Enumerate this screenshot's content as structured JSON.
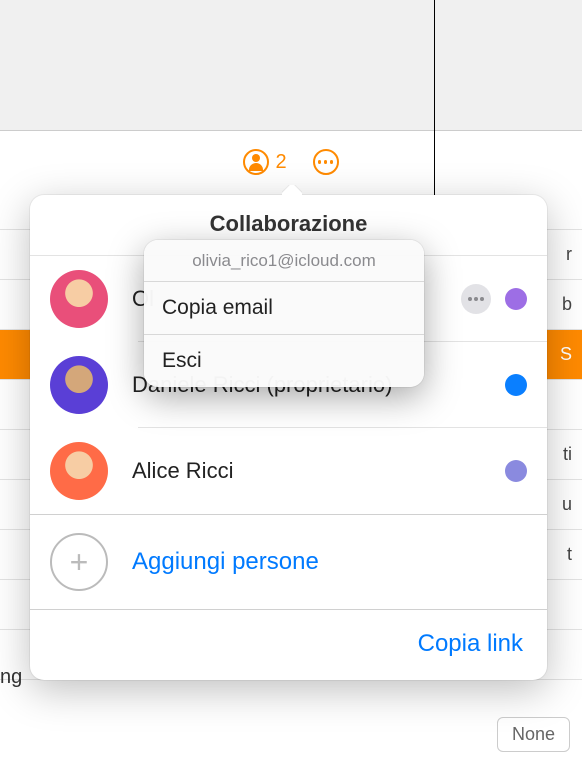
{
  "toolbar": {
    "collab_count": "2"
  },
  "popover": {
    "title": "Collaborazione",
    "participants": [
      {
        "name": "Ol",
        "has_more": true,
        "color": "purple"
      },
      {
        "name": "Daniele Ricci (proprietario)",
        "has_more": false,
        "color": "blue"
      },
      {
        "name": "Alice Ricci",
        "has_more": false,
        "color": "lav"
      }
    ],
    "add_label": "Aggiungi persone",
    "copy_link": "Copia link"
  },
  "context_menu": {
    "email": "olivia_rico1@icloud.com",
    "items": [
      "Copia email",
      "Esci"
    ]
  },
  "background": {
    "partial_right": [
      "r",
      "b",
      "S",
      "ti",
      "u",
      "t"
    ],
    "partial_left": "ng",
    "bottom_box": "None"
  }
}
